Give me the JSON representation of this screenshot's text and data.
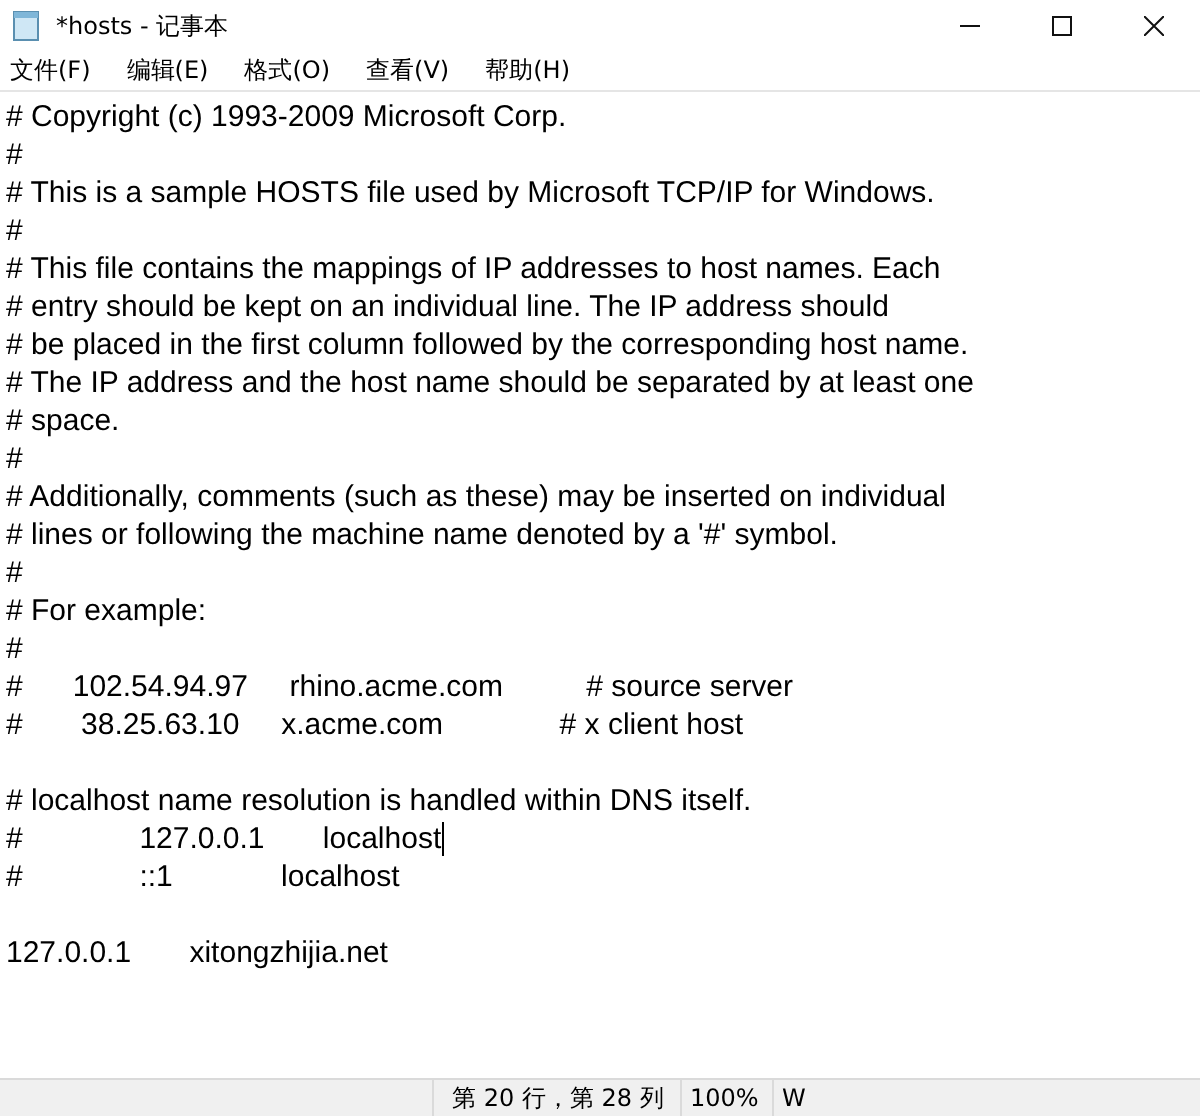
{
  "window": {
    "title": "*hosts - 记事本"
  },
  "menu": [
    "文件(F)",
    "编辑(E)",
    "格式(O)",
    "查看(V)",
    "帮助(H)"
  ],
  "lines": [
    {
      "kind": "text",
      "text": "# Copyright (c) 1993-2009 Microsoft Corp."
    },
    {
      "kind": "text",
      "text": "#"
    },
    {
      "kind": "text",
      "text": "# This is a sample HOSTS file used by Microsoft TCP/IP for Windows."
    },
    {
      "kind": "text",
      "text": "#"
    },
    {
      "kind": "text",
      "text": "# This file contains the mappings of IP addresses to host names. Each"
    },
    {
      "kind": "text",
      "text": "# entry should be kept on an individual line. The IP address should"
    },
    {
      "kind": "text",
      "text": "# be placed in the first column followed by the corresponding host name."
    },
    {
      "kind": "text",
      "text": "# The IP address and the host name should be separated by at least one"
    },
    {
      "kind": "text",
      "text": "# space."
    },
    {
      "kind": "text",
      "text": "#"
    },
    {
      "kind": "text",
      "text": "# Additionally, comments (such as these) may be inserted on individual"
    },
    {
      "kind": "text",
      "text": "# lines or following the machine name denoted by a '#' symbol."
    },
    {
      "kind": "text",
      "text": "#"
    },
    {
      "kind": "text",
      "text": "# For example:"
    },
    {
      "kind": "text",
      "text": "#"
    },
    {
      "kind": "text",
      "text": "#      102.54.94.97     rhino.acme.com          # source server"
    },
    {
      "kind": "text",
      "text": "#       38.25.63.10     x.acme.com              # x client host"
    },
    {
      "kind": "blank"
    },
    {
      "kind": "text",
      "text": "# localhost name resolution is handled within DNS itself."
    },
    {
      "kind": "text",
      "text": "#\t127.0.0.1       localhost",
      "caret": true
    },
    {
      "kind": "text",
      "text": "#\t::1             localhost"
    },
    {
      "kind": "blank"
    },
    {
      "kind": "text",
      "text": "127.0.0.1       xitongzhijia.net"
    }
  ],
  "status_bar": {
    "position": "第 20 行，第 28 列",
    "zoom": "100%",
    "encoding": "W"
  }
}
